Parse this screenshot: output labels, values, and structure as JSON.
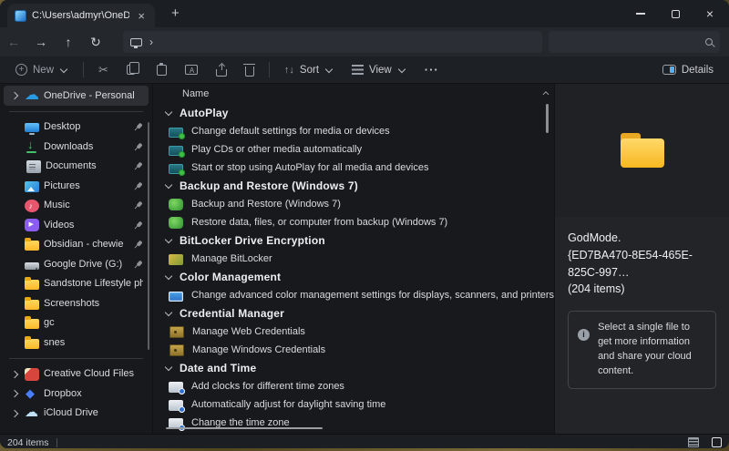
{
  "window": {
    "tab": {
      "title": "C:\\Users\\admyr\\OneDrive\\Des",
      "new_tab_icon": "+"
    }
  },
  "icons": {
    "back": "←",
    "forward": "→",
    "up": "↑",
    "refresh": "↻",
    "close": "×",
    "minimize": "line",
    "maximize": "square-outline",
    "cut": "✂",
    "sort": "↑↓",
    "more": "···",
    "search": "magnifier-shape",
    "this_pc": "monitor-shape",
    "breadcrumb_chevron": "›",
    "info": "i"
  },
  "navbar": {
    "search": {
      "placeholder": ""
    }
  },
  "toolbar": {
    "new_label": "New",
    "sort_label": "Sort",
    "view_label": "View",
    "details_label": "Details"
  },
  "sidebar": {
    "items": [
      {
        "label": "OneDrive - Personal",
        "icon": "onedrive-cloud",
        "chevron": true,
        "selected": true
      },
      {
        "type": "divider"
      },
      {
        "label": "Desktop",
        "icon": "desktop",
        "pinned": true
      },
      {
        "label": "Downloads",
        "icon": "downloads",
        "pinned": true
      },
      {
        "label": "Documents",
        "icon": "documents",
        "pinned": true
      },
      {
        "label": "Pictures",
        "icon": "pictures",
        "pinned": true
      },
      {
        "label": "Music",
        "icon": "music",
        "pinned": true
      },
      {
        "label": "Videos",
        "icon": "videos",
        "pinned": true
      },
      {
        "label": "Obsidian - chewie",
        "icon": "folder",
        "pinned": true
      },
      {
        "label": "Google Drive (G:)",
        "icon": "drive",
        "pinned": true
      },
      {
        "label": "Sandstone Lifestyle photos",
        "icon": "folder",
        "pinned": false
      },
      {
        "label": "Screenshots",
        "icon": "folder",
        "pinned": false
      },
      {
        "label": "gc",
        "icon": "folder",
        "pinned": false
      },
      {
        "label": "snes",
        "icon": "folder",
        "pinned": false
      },
      {
        "type": "divider"
      },
      {
        "label": "Creative Cloud Files",
        "icon": "creative-cloud",
        "chevron": true
      },
      {
        "label": "Dropbox",
        "icon": "dropbox",
        "chevron": true
      },
      {
        "label": "iCloud Drive",
        "icon": "icloud",
        "chevron": true
      }
    ]
  },
  "list": {
    "column_header": "Name",
    "groups": [
      {
        "label": "AutoPlay",
        "items": [
          {
            "label": "Change default settings for media or devices",
            "icon": "autoplay"
          },
          {
            "label": "Play CDs or other media automatically",
            "icon": "autoplay"
          },
          {
            "label": "Start or stop using AutoPlay for all media and devices",
            "icon": "autoplay"
          }
        ]
      },
      {
        "label": "Backup and Restore (Windows 7)",
        "items": [
          {
            "label": "Backup and Restore (Windows 7)",
            "icon": "backup"
          },
          {
            "label": "Restore data, files, or computer from backup (Windows 7)",
            "icon": "backup"
          }
        ]
      },
      {
        "label": "BitLocker Drive Encryption",
        "items": [
          {
            "label": "Manage BitLocker",
            "icon": "bitlocker"
          }
        ]
      },
      {
        "label": "Color Management",
        "items": [
          {
            "label": "Change advanced color management settings for displays, scanners, and printers",
            "icon": "color-management"
          }
        ]
      },
      {
        "label": "Credential Manager",
        "items": [
          {
            "label": "Manage Web Credentials",
            "icon": "credential"
          },
          {
            "label": "Manage Windows Credentials",
            "icon": "credential"
          }
        ]
      },
      {
        "label": "Date and Time",
        "items": [
          {
            "label": "Add clocks for different time zones",
            "icon": "datetime"
          },
          {
            "label": "Automatically adjust for daylight saving time",
            "icon": "datetime"
          },
          {
            "label": "Change the time zone",
            "icon": "datetime"
          }
        ]
      }
    ]
  },
  "details": {
    "title_line1": "GodMode.",
    "title_line2": "{ED7BA470-8E54-465E-825C-997…",
    "title_line3": "(204 items)",
    "info_text": "Select a single file to get more information and share your cloud content."
  },
  "statusbar": {
    "items_count": "204 items"
  },
  "colors": {
    "accent_blue": "#58aef0",
    "folder_yellow": "#f7b722",
    "selected_row": "#2d2f34",
    "window_bg": "#17191d",
    "chrome_bg": "#24272c"
  }
}
